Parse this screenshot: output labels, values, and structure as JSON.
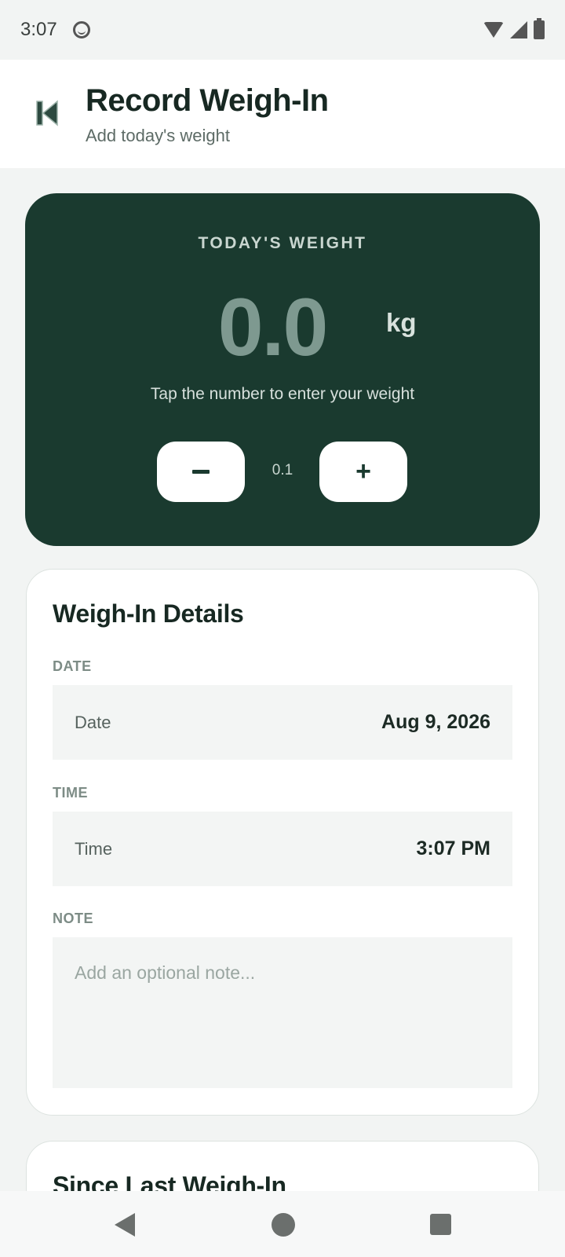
{
  "status_bar": {
    "time": "3:07"
  },
  "header": {
    "title": "Record Weigh-In",
    "subtitle": "Add today's weight",
    "back_icon": "skip-back-icon"
  },
  "weight_card": {
    "label": "TODAY'S WEIGHT",
    "value": "0.0",
    "unit": "kg",
    "hint": "Tap the number to enter your weight",
    "decrement_label": "−",
    "increment_label": "+",
    "step_size": "0.1"
  },
  "details": {
    "title": "Weigh-In Details",
    "date": {
      "section_label": "DATE",
      "row_label": "Date",
      "value": "Aug 9, 2026"
    },
    "time": {
      "section_label": "TIME",
      "row_label": "Time",
      "value": "3:07 PM"
    },
    "note": {
      "section_label": "NOTE",
      "placeholder": "Add an optional note..."
    }
  },
  "since_last": {
    "title": "Since Last Weigh-In"
  },
  "colors": {
    "brand_dark_green": "#1a3a2f",
    "background": "#f2f4f3",
    "weight_value": "#7e9990"
  }
}
